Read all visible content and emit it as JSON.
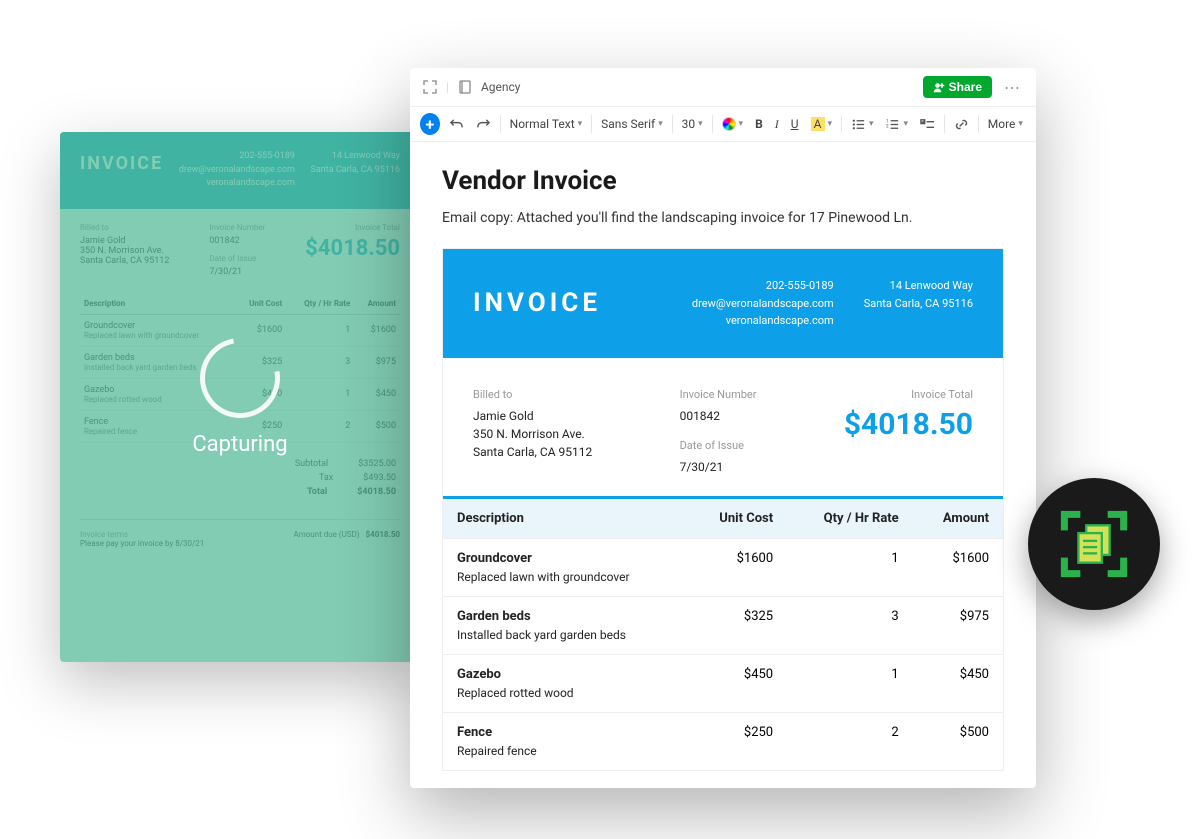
{
  "back": {
    "logo": "INVOICE",
    "phone": "202-555-0189",
    "email": "drew@veronalandscape.com",
    "site": "veronalandscape.com",
    "addr1": "14 Lenwood Way",
    "addr2": "Santa Carla, CA 95116",
    "billedto_lbl": "Billed to",
    "bill_name": "Jamie Gold",
    "bill_addr1": "350 N. Morrison Ave.",
    "bill_addr2": "Santa Carla, CA 95112",
    "invnum_lbl": "Invoice Number",
    "invnum": "001842",
    "date_lbl": "Date of Issue",
    "date": "7/30/21",
    "total_lbl": "Invoice Total",
    "total": "$4018.50",
    "cols": {
      "desc": "Description",
      "unit": "Unit Cost",
      "qty": "Qty / Hr Rate",
      "amt": "Amount"
    },
    "rows": [
      {
        "desc": "Groundcover",
        "sub": "Replaced lawn with groundcover",
        "unit": "$1600",
        "qty": "1",
        "amt": "$1600"
      },
      {
        "desc": "Garden beds",
        "sub": "Installed back yard garden beds",
        "unit": "$325",
        "qty": "3",
        "amt": "$975"
      },
      {
        "desc": "Gazebo",
        "sub": "Replaced rotted wood",
        "unit": "$450",
        "qty": "1",
        "amt": "$450"
      },
      {
        "desc": "Fence",
        "sub": "Repaired fence",
        "unit": "$250",
        "qty": "2",
        "amt": "$500"
      }
    ],
    "subtotal_lbl": "Subtotal",
    "subtotal": "$3525.00",
    "tax_lbl": "Tax",
    "tax": "$493.50",
    "tl_lbl": "Total",
    "tl": "$4018.50",
    "terms_lbl": "Invoice terms",
    "terms": "Please pay your invoice by 8/30/21",
    "due_lbl": "Amount due (USD)",
    "due": "$4018.50",
    "overlay": "Capturing"
  },
  "editor": {
    "notebook": "Agency",
    "share": "Share",
    "toolbar": {
      "style": "Normal Text",
      "font": "Sans Serif",
      "size": "30",
      "b": "B",
      "i": "I",
      "u": "U",
      "a": "A",
      "more": "More"
    },
    "title": "Vendor Invoice",
    "body": "Email copy: Attached you'll find the landscaping invoice for 17 Pinewood Ln."
  },
  "inv": {
    "logo": "INVOICE",
    "phone": "202-555-0189",
    "email": "drew@veronalandscape.com",
    "site": "veronalandscape.com",
    "addr1": "14 Lenwood Way",
    "addr2": "Santa Carla, CA 95116",
    "billedto_lbl": "Billed to",
    "bill_name": "Jamie Gold",
    "bill_addr1": "350 N. Morrison Ave.",
    "bill_addr2": "Santa Carla, CA 95112",
    "invnum_lbl": "Invoice Number",
    "invnum": "001842",
    "date_lbl": "Date of Issue",
    "date": "7/30/21",
    "total_lbl": "Invoice Total",
    "total": "$4018.50",
    "cols": {
      "desc": "Description",
      "unit": "Unit Cost",
      "qty": "Qty / Hr Rate",
      "amt": "Amount"
    },
    "rows": [
      {
        "desc": "Groundcover",
        "sub": "Replaced lawn with groundcover",
        "unit": "$1600",
        "qty": "1",
        "amt": "$1600"
      },
      {
        "desc": "Garden beds",
        "sub": "Installed back yard garden beds",
        "unit": "$325",
        "qty": "3",
        "amt": "$975"
      },
      {
        "desc": "Gazebo",
        "sub": "Replaced rotted wood",
        "unit": "$450",
        "qty": "1",
        "amt": "$450"
      },
      {
        "desc": "Fence",
        "sub": "Repaired fence",
        "unit": "$250",
        "qty": "2",
        "amt": "$500"
      }
    ]
  }
}
